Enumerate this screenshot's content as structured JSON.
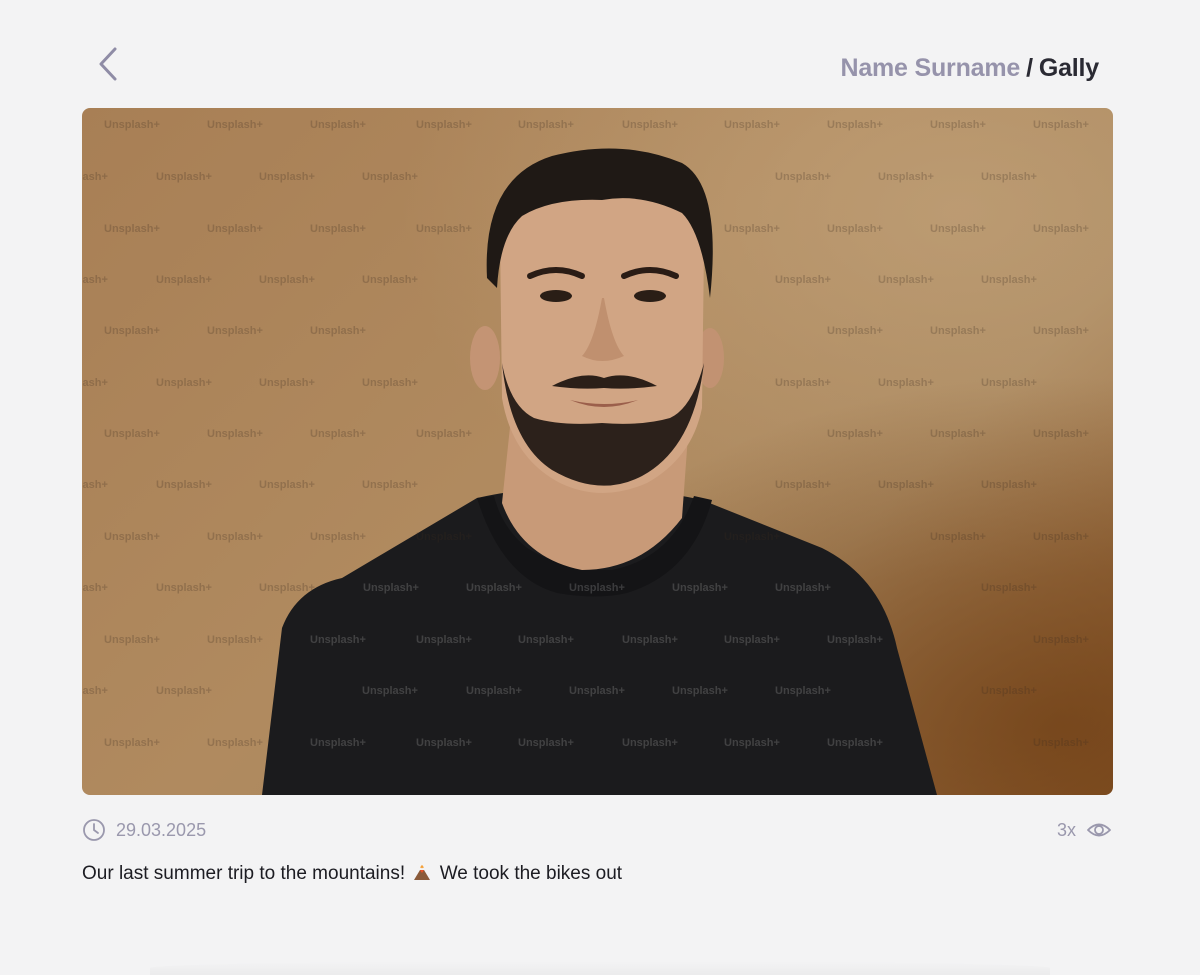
{
  "header": {
    "back_icon": "chevron-left-icon",
    "owner_name": "Name Surname",
    "separator": "/",
    "album_name": "Gally"
  },
  "photo": {
    "watermark_text": "Unsplash+",
    "subject": "portrait-photo"
  },
  "meta": {
    "date": "29.03.2025",
    "date_icon": "clock-icon",
    "views": "3x",
    "views_icon": "eye-icon"
  },
  "caption": {
    "text_before": "Our last summer trip to the mountains!",
    "emoji_icon": "volcano-emoji-icon",
    "text_after": "We took the bikes out"
  },
  "colors": {
    "background": "#f3f3f4",
    "muted": "#9693ab",
    "dark": "#2a2a33"
  }
}
